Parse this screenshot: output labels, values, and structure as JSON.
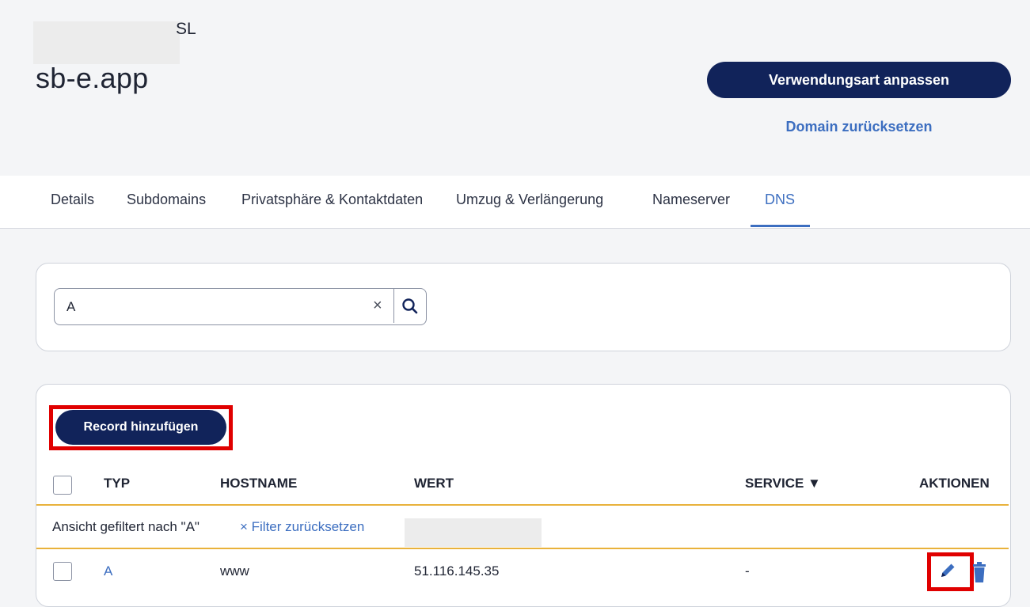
{
  "header": {
    "owner_suffix": "SL",
    "domain": "sb-e.app",
    "primary_button": "Verwendungsart anpassen",
    "reset_link": "Domain zurücksetzen"
  },
  "tabs": [
    {
      "label": "Details",
      "active": false
    },
    {
      "label": "Subdomains",
      "active": false
    },
    {
      "label": "Privatsphäre & Kontaktdaten",
      "active": false
    },
    {
      "label": "Umzug & Verlängerung",
      "active": false
    },
    {
      "label": "Nameserver",
      "active": false
    },
    {
      "label": "DNS",
      "active": true
    }
  ],
  "search": {
    "value": "A",
    "clear_glyph": "×",
    "button_icon": "search-icon"
  },
  "records": {
    "add_button": "Record hinzufügen",
    "columns": {
      "type": "TYP",
      "hostname": "HOSTNAME",
      "value": "WERT",
      "service": "SERVICE ▼",
      "actions": "AKTIONEN"
    },
    "filter": {
      "text": "Ansicht gefiltert nach \"A\"",
      "reset": "× Filter zurücksetzen"
    },
    "rows": [
      {
        "type": "A",
        "hostname": "www",
        "value": "51.116.145.35",
        "service": "-"
      }
    ],
    "action_icons": [
      "pencil-icon",
      "trash-icon"
    ]
  },
  "colors": {
    "primary": "#11235a",
    "link": "#3c6ec0",
    "row_border": "#e9b23b",
    "highlight": "#e00000"
  }
}
